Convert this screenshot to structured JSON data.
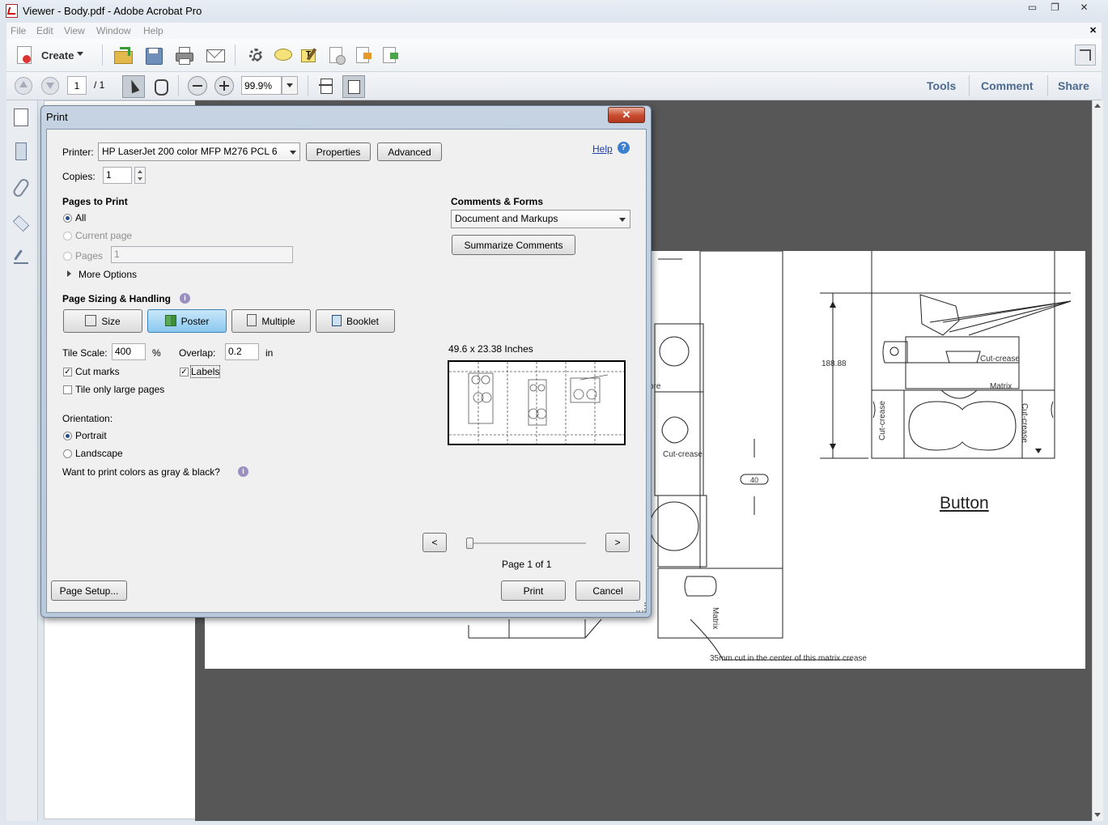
{
  "window": {
    "title": "Viewer - Body.pdf - Adobe Acrobat Pro",
    "minimize": "▭",
    "restore": "❐",
    "close": "✕",
    "doc_close": "✕"
  },
  "menubar": {
    "items": [
      "File",
      "Edit",
      "View",
      "Window",
      "Help"
    ]
  },
  "toolbar": {
    "create_label": "Create",
    "icons": [
      "open-folder-icon",
      "save-icon",
      "print-icon",
      "email-icon",
      "gear-icon",
      "comment-bubble-icon",
      "highlight-icon",
      "sign-icon",
      "export-icon",
      "share-icon"
    ]
  },
  "navbar": {
    "page_current": "1",
    "page_total": "/ 1",
    "zoom": "99.9%",
    "tools_link": "Tools",
    "comment_link": "Comment",
    "share_link": "Share"
  },
  "print_dialog": {
    "title": "Print",
    "close_label": "✕",
    "printer_label": "Printer:",
    "printer_value": "HP LaserJet 200 color MFP M276 PCL 6",
    "properties_button": "Properties",
    "advanced_button": "Advanced",
    "help_link": "Help",
    "copies_label": "Copies:",
    "copies_value": "1",
    "pages_to_print": {
      "heading": "Pages to Print",
      "all": "All",
      "current_page": "Current page",
      "pages": "Pages",
      "pages_value": "1",
      "more_options": "More Options"
    },
    "page_sizing": {
      "heading": "Page Sizing & Handling",
      "size_button": "Size",
      "poster_button": "Poster",
      "multiple_button": "Multiple",
      "booklet_button": "Booklet"
    },
    "tile_scale_label": "Tile Scale:",
    "tile_scale_value": "400",
    "percent": "%",
    "overlap_label": "Overlap:",
    "overlap_value": "0.2",
    "overlap_unit": "in",
    "cut_marks": "Cut marks",
    "labels": "Labels",
    "tile_only_large": "Tile only large pages",
    "orientation_label": "Orientation:",
    "portrait": "Portrait",
    "landscape": "Landscape",
    "gray_question": "Want to print colors as gray & black?",
    "comments_forms": {
      "heading": "Comments & Forms",
      "value": "Document and Markups",
      "summarize_button": "Summarize Comments"
    },
    "preview": {
      "size_text": "49.6 x 23.38 Inches",
      "prev_button": "<",
      "next_button": ">",
      "page_indicator": "Page 1 of 1",
      "slider_position": 0
    },
    "page_setup_button": "Page Setup...",
    "print_button": "Print",
    "cancel_button": "Cancel"
  },
  "document": {
    "dimension_188": "188.88",
    "dimension_40": "40",
    "cut_crease_1": "Cut-crease",
    "cut_crease_2": "Cut-crease",
    "cut_crease_3": "Cut-crease",
    "cut_crease_4": "Cut-crease",
    "matrix_1": "Matrix",
    "matrix_2": "Matrix",
    "ore": "ore",
    "button_title": "Button",
    "note": "35mm cut in the center of this matrix crease"
  }
}
